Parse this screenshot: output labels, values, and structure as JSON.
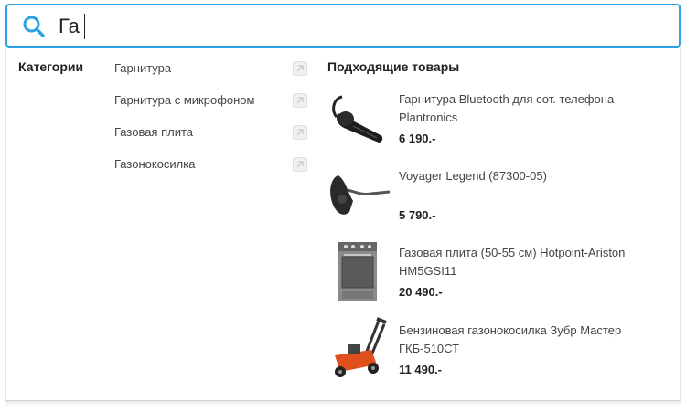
{
  "search": {
    "value": "Га"
  },
  "categories": {
    "title": "Категории",
    "items": [
      {
        "label": "Гарнитура"
      },
      {
        "label": "Гарнитура с микрофоном"
      },
      {
        "label": "Газовая плита"
      },
      {
        "label": "Газонокосилка"
      }
    ]
  },
  "products": {
    "title": "Подходящие товары",
    "items": [
      {
        "name": "Гарнитура Bluetooth для сот. телефона Plantronics",
        "price": "6 190.-",
        "icon": "headset-image"
      },
      {
        "name": "Voyager Legend (87300-05)",
        "price": "5 790.-",
        "icon": "headset-image"
      },
      {
        "name": "Газовая плита (50-55 см) Hotpoint-Ariston HM5GSI11",
        "price": "20 490.-",
        "icon": "gas-stove-image"
      },
      {
        "name": "Бензиновая газонокосилка Зубр Мастер ГКБ-510СТ",
        "price": "11 490.-",
        "icon": "lawn-mower-image"
      }
    ]
  },
  "colors": {
    "accent": "#2aa3e2"
  }
}
